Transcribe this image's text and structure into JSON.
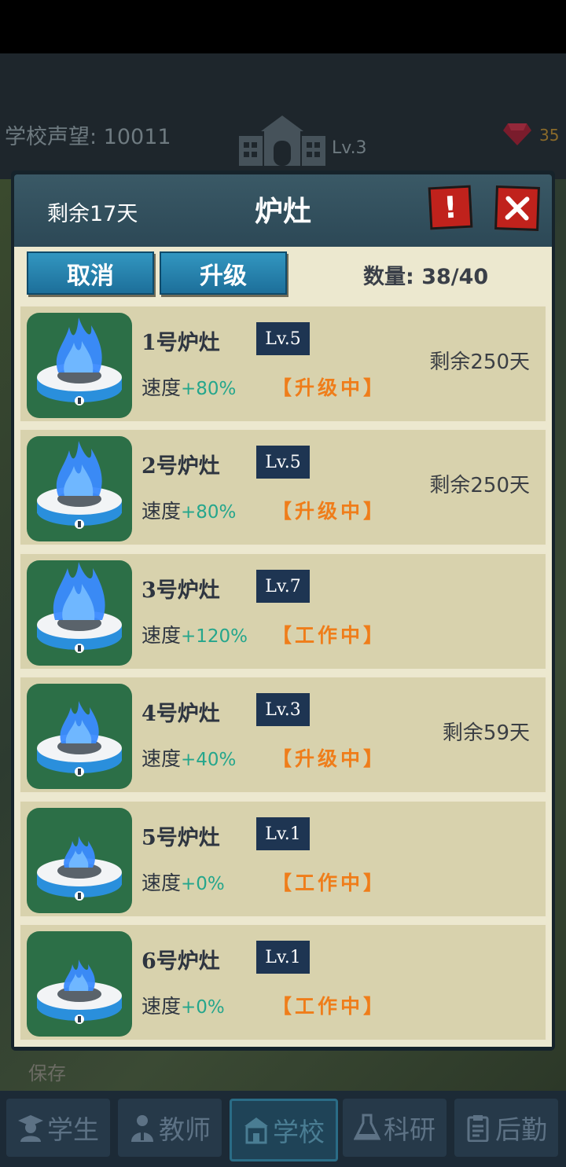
{
  "top": {
    "reputation_label": "学校声望: 10011",
    "school_level": "Lv.3",
    "gem_count": "35"
  },
  "dialog": {
    "remaining": "剩余17天",
    "title": "炉灶",
    "help_label": "!",
    "cancel_label": "取消",
    "upgrade_label": "升级",
    "quantity": "数量: 38/40"
  },
  "stoves": [
    {
      "name": "1号炉灶",
      "level": "Lv.5",
      "speed_label": "速度",
      "speed_value": "+80%",
      "status": "【升级中】",
      "days_left": "剩余250天"
    },
    {
      "name": "2号炉灶",
      "level": "Lv.5",
      "speed_label": "速度",
      "speed_value": "+80%",
      "status": "【升级中】",
      "days_left": "剩余250天"
    },
    {
      "name": "3号炉灶",
      "level": "Lv.7",
      "speed_label": "速度",
      "speed_value": "+120%",
      "status": "【工作中】",
      "days_left": ""
    },
    {
      "name": "4号炉灶",
      "level": "Lv.3",
      "speed_label": "速度",
      "speed_value": "+40%",
      "status": "【升级中】",
      "days_left": "剩余59天"
    },
    {
      "name": "5号炉灶",
      "level": "Lv.1",
      "speed_label": "速度",
      "speed_value": "+0%",
      "status": "【工作中】",
      "days_left": ""
    },
    {
      "name": "6号炉灶",
      "level": "Lv.1",
      "speed_label": "速度",
      "speed_value": "+0%",
      "status": "【工作中】",
      "days_left": ""
    }
  ],
  "background": {
    "save_label": "保存"
  },
  "nav": {
    "tabs": [
      {
        "label": "学生",
        "icon": "student-icon"
      },
      {
        "label": "教师",
        "icon": "teacher-icon"
      },
      {
        "label": "学校",
        "icon": "school-icon",
        "active": true
      },
      {
        "label": "科研",
        "icon": "flask-icon"
      },
      {
        "label": "后勤",
        "icon": "clipboard-icon"
      }
    ]
  },
  "colors": {
    "accent_blue": "#2a86b4",
    "status_orange": "#ef7d1a",
    "speed_green": "#25a68c",
    "close_red": "#c0221c"
  }
}
